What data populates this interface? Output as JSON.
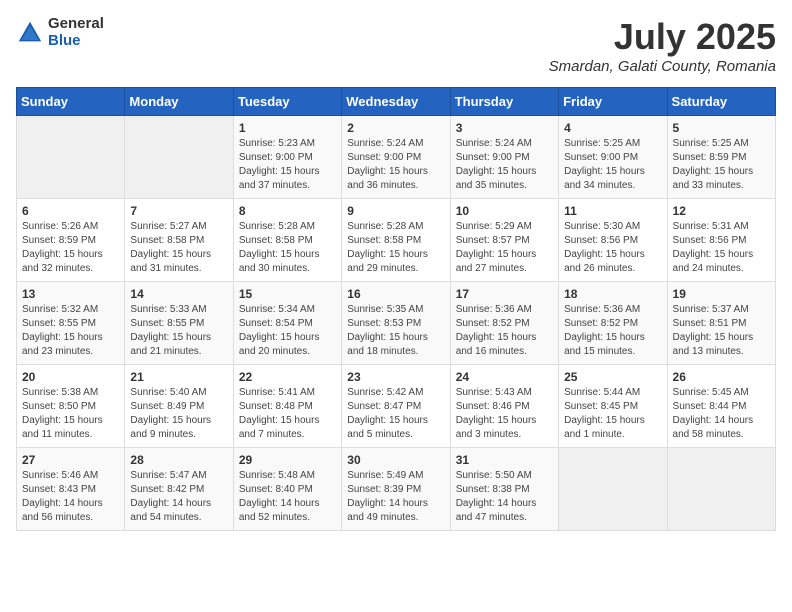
{
  "logo": {
    "general": "General",
    "blue": "Blue"
  },
  "title": {
    "month_year": "July 2025",
    "location": "Smardan, Galati County, Romania"
  },
  "weekdays": [
    "Sunday",
    "Monday",
    "Tuesday",
    "Wednesday",
    "Thursday",
    "Friday",
    "Saturday"
  ],
  "weeks": [
    [
      {
        "day": "",
        "info": ""
      },
      {
        "day": "",
        "info": ""
      },
      {
        "day": "1",
        "info": "Sunrise: 5:23 AM\nSunset: 9:00 PM\nDaylight: 15 hours and 37 minutes."
      },
      {
        "day": "2",
        "info": "Sunrise: 5:24 AM\nSunset: 9:00 PM\nDaylight: 15 hours and 36 minutes."
      },
      {
        "day": "3",
        "info": "Sunrise: 5:24 AM\nSunset: 9:00 PM\nDaylight: 15 hours and 35 minutes."
      },
      {
        "day": "4",
        "info": "Sunrise: 5:25 AM\nSunset: 9:00 PM\nDaylight: 15 hours and 34 minutes."
      },
      {
        "day": "5",
        "info": "Sunrise: 5:25 AM\nSunset: 8:59 PM\nDaylight: 15 hours and 33 minutes."
      }
    ],
    [
      {
        "day": "6",
        "info": "Sunrise: 5:26 AM\nSunset: 8:59 PM\nDaylight: 15 hours and 32 minutes."
      },
      {
        "day": "7",
        "info": "Sunrise: 5:27 AM\nSunset: 8:58 PM\nDaylight: 15 hours and 31 minutes."
      },
      {
        "day": "8",
        "info": "Sunrise: 5:28 AM\nSunset: 8:58 PM\nDaylight: 15 hours and 30 minutes."
      },
      {
        "day": "9",
        "info": "Sunrise: 5:28 AM\nSunset: 8:58 PM\nDaylight: 15 hours and 29 minutes."
      },
      {
        "day": "10",
        "info": "Sunrise: 5:29 AM\nSunset: 8:57 PM\nDaylight: 15 hours and 27 minutes."
      },
      {
        "day": "11",
        "info": "Sunrise: 5:30 AM\nSunset: 8:56 PM\nDaylight: 15 hours and 26 minutes."
      },
      {
        "day": "12",
        "info": "Sunrise: 5:31 AM\nSunset: 8:56 PM\nDaylight: 15 hours and 24 minutes."
      }
    ],
    [
      {
        "day": "13",
        "info": "Sunrise: 5:32 AM\nSunset: 8:55 PM\nDaylight: 15 hours and 23 minutes."
      },
      {
        "day": "14",
        "info": "Sunrise: 5:33 AM\nSunset: 8:55 PM\nDaylight: 15 hours and 21 minutes."
      },
      {
        "day": "15",
        "info": "Sunrise: 5:34 AM\nSunset: 8:54 PM\nDaylight: 15 hours and 20 minutes."
      },
      {
        "day": "16",
        "info": "Sunrise: 5:35 AM\nSunset: 8:53 PM\nDaylight: 15 hours and 18 minutes."
      },
      {
        "day": "17",
        "info": "Sunrise: 5:36 AM\nSunset: 8:52 PM\nDaylight: 15 hours and 16 minutes."
      },
      {
        "day": "18",
        "info": "Sunrise: 5:36 AM\nSunset: 8:52 PM\nDaylight: 15 hours and 15 minutes."
      },
      {
        "day": "19",
        "info": "Sunrise: 5:37 AM\nSunset: 8:51 PM\nDaylight: 15 hours and 13 minutes."
      }
    ],
    [
      {
        "day": "20",
        "info": "Sunrise: 5:38 AM\nSunset: 8:50 PM\nDaylight: 15 hours and 11 minutes."
      },
      {
        "day": "21",
        "info": "Sunrise: 5:40 AM\nSunset: 8:49 PM\nDaylight: 15 hours and 9 minutes."
      },
      {
        "day": "22",
        "info": "Sunrise: 5:41 AM\nSunset: 8:48 PM\nDaylight: 15 hours and 7 minutes."
      },
      {
        "day": "23",
        "info": "Sunrise: 5:42 AM\nSunset: 8:47 PM\nDaylight: 15 hours and 5 minutes."
      },
      {
        "day": "24",
        "info": "Sunrise: 5:43 AM\nSunset: 8:46 PM\nDaylight: 15 hours and 3 minutes."
      },
      {
        "day": "25",
        "info": "Sunrise: 5:44 AM\nSunset: 8:45 PM\nDaylight: 15 hours and 1 minute."
      },
      {
        "day": "26",
        "info": "Sunrise: 5:45 AM\nSunset: 8:44 PM\nDaylight: 14 hours and 58 minutes."
      }
    ],
    [
      {
        "day": "27",
        "info": "Sunrise: 5:46 AM\nSunset: 8:43 PM\nDaylight: 14 hours and 56 minutes."
      },
      {
        "day": "28",
        "info": "Sunrise: 5:47 AM\nSunset: 8:42 PM\nDaylight: 14 hours and 54 minutes."
      },
      {
        "day": "29",
        "info": "Sunrise: 5:48 AM\nSunset: 8:40 PM\nDaylight: 14 hours and 52 minutes."
      },
      {
        "day": "30",
        "info": "Sunrise: 5:49 AM\nSunset: 8:39 PM\nDaylight: 14 hours and 49 minutes."
      },
      {
        "day": "31",
        "info": "Sunrise: 5:50 AM\nSunset: 8:38 PM\nDaylight: 14 hours and 47 minutes."
      },
      {
        "day": "",
        "info": ""
      },
      {
        "day": "",
        "info": ""
      }
    ]
  ]
}
